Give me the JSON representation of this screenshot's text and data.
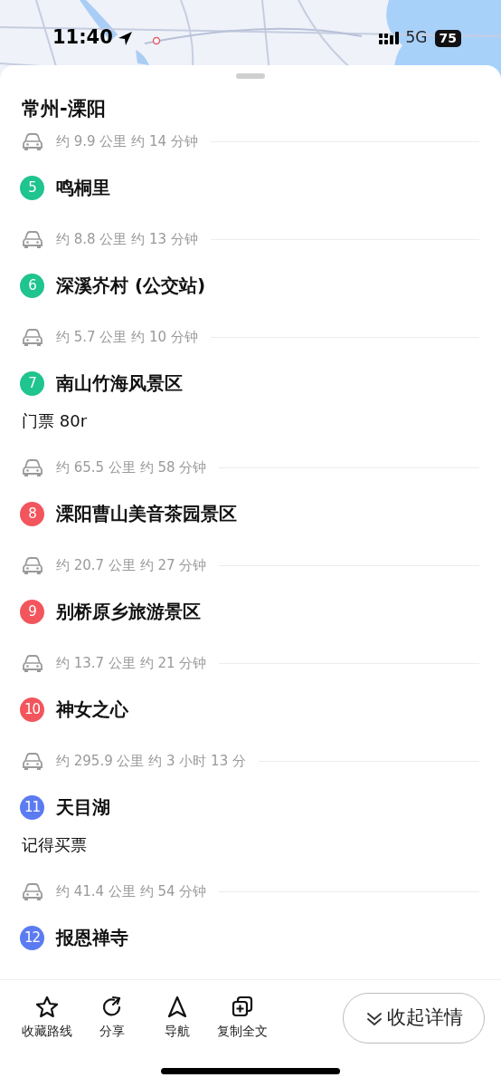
{
  "status_bar": {
    "time": "11:40",
    "network": "5G",
    "battery": "75"
  },
  "route": {
    "title": "常州-溧阳",
    "items": [
      {
        "kind": "segment",
        "text": "约 9.9 公里 约 14 分钟"
      },
      {
        "kind": "stop",
        "number": "5",
        "name": "鸣桐里",
        "color": "#1fc48e"
      },
      {
        "kind": "segment",
        "text": "约 8.8 公里 约 13 分钟"
      },
      {
        "kind": "stop",
        "number": "6",
        "name": "深溪岕村 (公交站)",
        "color": "#1fc48e"
      },
      {
        "kind": "segment",
        "text": "约 5.7 公里 约 10 分钟"
      },
      {
        "kind": "stop",
        "number": "7",
        "name": "南山竹海风景区",
        "color": "#1fc48e",
        "note": "门票 80r"
      },
      {
        "kind": "segment",
        "text": "约 65.5 公里 约 58 分钟"
      },
      {
        "kind": "stop",
        "number": "8",
        "name": "溧阳曹山美音茶园景区",
        "color": "#f2555c"
      },
      {
        "kind": "segment",
        "text": "约 20.7 公里 约 27 分钟"
      },
      {
        "kind": "stop",
        "number": "9",
        "name": "别桥原乡旅游景区",
        "color": "#f2555c"
      },
      {
        "kind": "segment",
        "text": "约 13.7 公里 约 21 分钟"
      },
      {
        "kind": "stop",
        "number": "10",
        "name": "神女之心",
        "color": "#f2555c"
      },
      {
        "kind": "segment",
        "text": "约 295.9 公里 约 3 小时 13 分"
      },
      {
        "kind": "stop",
        "number": "11",
        "name": "天目湖",
        "color": "#5b7bf2",
        "note": "记得买票"
      },
      {
        "kind": "segment",
        "text": "约 41.4 公里 约 54 分钟"
      },
      {
        "kind": "stop",
        "number": "12",
        "name": "报恩禅寺",
        "color": "#5b7bf2"
      }
    ]
  },
  "toolbar": [
    {
      "kind": "star",
      "label": "收藏路线"
    },
    {
      "kind": "share",
      "label": "分享"
    },
    {
      "kind": "navigate",
      "label": "导航"
    },
    {
      "kind": "copy",
      "label": "复制全文"
    }
  ],
  "collapse_button": {
    "label": "收起详情"
  }
}
